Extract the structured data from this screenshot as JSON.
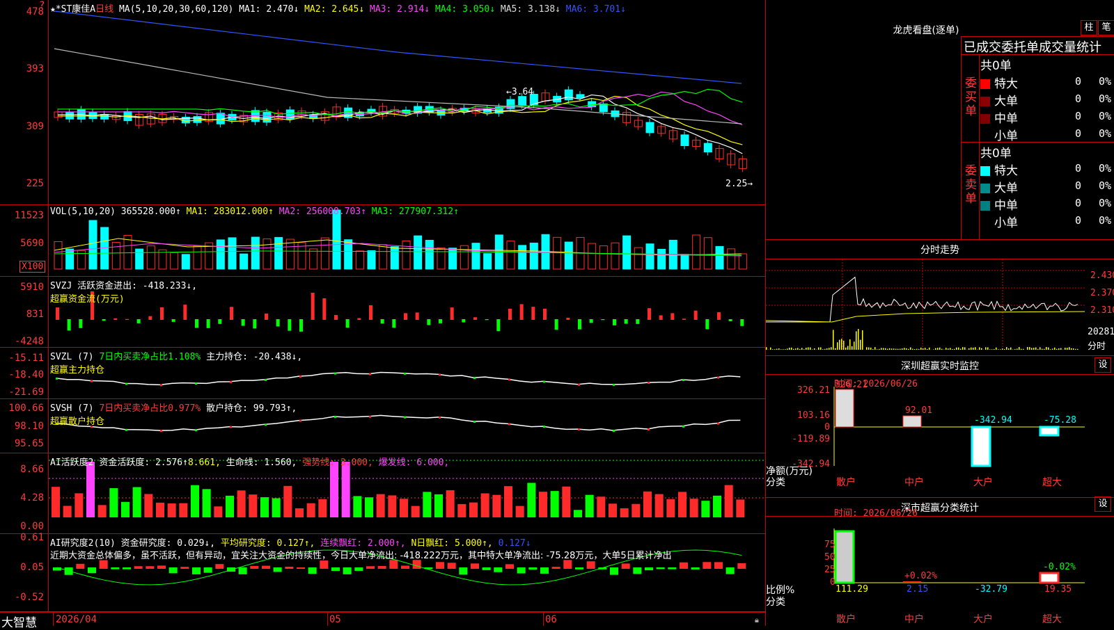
{
  "kline": {
    "stock": "★*ST康佳A",
    "period": "日线",
    "ma_spec": "MA(5,10,20,30,60,120)",
    "ma1": "MA1: 2.470↓",
    "ma2": "MA2: 2.645↓",
    "ma3": "MA3: 2.914↓",
    "ma4": "MA4: 3.050↓",
    "ma5": "MA5: 3.138↓",
    "ma6": "MA6: 3.701↓",
    "yticks": [
      "478",
      "393",
      "309",
      "225"
    ],
    "high_label": "←3.64",
    "low_label": "2.25→",
    "corner_mark": "?"
  },
  "vol": {
    "spec": "VOL(5,10,20)",
    "value": "365528.000↑",
    "ma1": "MA1: 283012.000↑",
    "ma2": "MA2: 256008.703↑",
    "ma3": "MA3: 277907.312↑",
    "yticks": [
      "11523",
      "5690"
    ],
    "unit": "X100"
  },
  "svzj": {
    "title": "SVZJ",
    "value": "活跃资金进出: -418.233↓,",
    "subtitle": "超赢资金流(万元)",
    "yticks": [
      "5910",
      "831",
      "-4248"
    ]
  },
  "svzl": {
    "title": "SVZL (7)",
    "ratio": "7日内买卖净占比1.108%",
    "value": "主力持仓: -20.438↓,",
    "subtitle": "超赢主力持仓",
    "yticks": [
      "-15.11",
      "-18.40",
      "-21.69"
    ]
  },
  "svsh": {
    "title": "SVSH (7)",
    "ratio": "7日内买卖净占比0.977%",
    "value": "散户持仓: 99.793↑,",
    "subtitle": "超赢散户持仓",
    "yticks": [
      "100.66",
      "98.10",
      "95.65"
    ]
  },
  "ai_active": {
    "title": "AI活跃度2",
    "value": "资金活跃度: 2.576↑",
    "v2": "8.661,",
    "life": "生命线: 1.560,",
    "strong": "强势线: 3.000,",
    "burst": "爆发线: 6.000,",
    "yticks": [
      "8.66",
      "4.28",
      "0.00"
    ]
  },
  "ai_research": {
    "title": "AI研究度2(10)",
    "value": "资金研究度: 0.029↓,",
    "avg": "平均研究度: 0.127↑,",
    "red": "连续飘红: 2.000↑,",
    "nred": "N日飘红: 5.000↑,",
    "last": "0.127↓",
    "comment": "近期大资金总体偏多，虽不活跃，但有异动，宜关注大资金的持续性，今日大单净流出: -418.222万元，其中特大单净流出: -75.28万元，大单5日累计净出",
    "yticks": [
      "0.61",
      "0.05",
      "-0.52"
    ]
  },
  "bottom_bar": {
    "app_name": "大智慧",
    "dates": [
      "2026/04",
      "05",
      "06"
    ]
  },
  "dragon": {
    "title": "龙虎看盘(逐单)",
    "btn_bar": "柱",
    "btn_pen": "笔",
    "header": "已成交委托单成交量统计",
    "buy_label": "委买单",
    "sell_label": "委卖单",
    "buy_total": "共0单",
    "sell_total": "共0单",
    "buy_rows": [
      {
        "label": "特大",
        "count": "0",
        "pct": "0%"
      },
      {
        "label": "大单",
        "count": "0",
        "pct": "0%"
      },
      {
        "label": "中单",
        "count": "0",
        "pct": "0%"
      },
      {
        "label": "小单",
        "count": "0",
        "pct": "0%"
      }
    ],
    "sell_rows": [
      {
        "label": "特大",
        "count": "0",
        "pct": "0%"
      },
      {
        "label": "大单",
        "count": "0",
        "pct": "0%"
      },
      {
        "label": "中单",
        "count": "0",
        "pct": "0%"
      },
      {
        "label": "小单",
        "count": "0",
        "pct": "0%"
      }
    ],
    "colors": {
      "buy_xl": "#ff0000",
      "buy_l": "#8b0000",
      "buy_m": "#800000",
      "sell_xl": "#00ffff",
      "sell_l": "#008b8b",
      "sell_m": "#008080"
    }
  },
  "intraday": {
    "title": "分时走势",
    "prices": [
      "2.430",
      "2.370",
      "2.310"
    ],
    "vol_label": "20281",
    "unit": "分时"
  },
  "sz_monitor": {
    "title": "深圳超赢实时监控",
    "set_btn": "设",
    "time": "时间: 2026/06/26",
    "yticks": [
      "326.21",
      "103.16",
      "0",
      "-119.89",
      "-342.94"
    ],
    "ylabel": "净额(万元)",
    "xlabel": "分类",
    "categories": [
      "散户",
      "中户",
      "大户",
      "超大"
    ],
    "values": [
      "326.21",
      "92.01",
      "-342.94",
      "-75.28"
    ]
  },
  "sz_class": {
    "title": "深市超赢分类统计",
    "set_btn": "设",
    "time": "时间: 2026/06/26",
    "yticks": [
      "75",
      "50",
      "25",
      "0"
    ],
    "ylabel": "比例%",
    "xlabel": "分类",
    "categories": [
      "散户",
      "中户",
      "大户",
      "超大"
    ],
    "values": [
      "111.29",
      "2.15",
      "-32.79",
      "19.35"
    ],
    "pct_labels": [
      "+0.02%",
      "-0.02%"
    ]
  }
}
